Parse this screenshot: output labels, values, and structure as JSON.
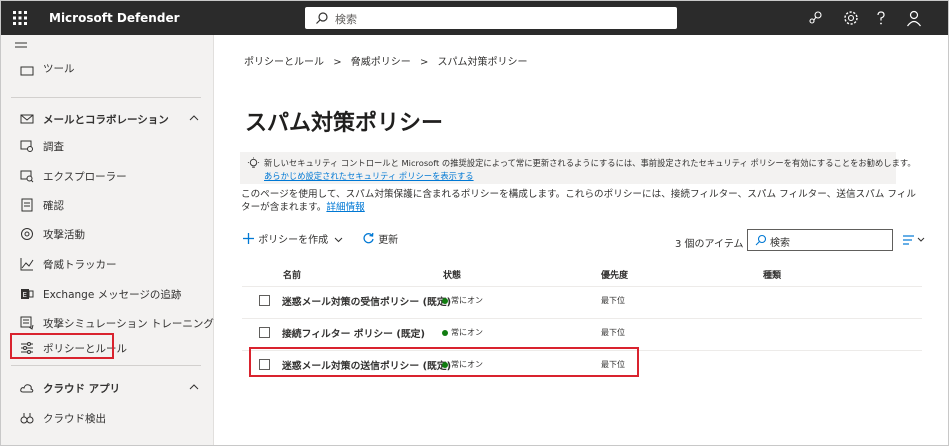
{
  "topbar": {
    "app_title": "Microsoft Defender",
    "search_placeholder": "検索",
    "icons": [
      "app-launcher-icon",
      "search-icon",
      "connection-icon",
      "settings-icon",
      "help-icon",
      "account-icon"
    ]
  },
  "sidebar": {
    "partial_item": "ツール",
    "items": [
      {
        "label": "メールとコラボレーション",
        "icon": "mail-icon"
      },
      {
        "label": "調査",
        "icon": "investigation-icon"
      },
      {
        "label": "エクスプローラー",
        "icon": "explorer-icon"
      },
      {
        "label": "確認",
        "icon": "review-icon"
      },
      {
        "label": "攻撃活動",
        "icon": "campaign-icon"
      },
      {
        "label": "脅威トラッカー",
        "icon": "trend-icon"
      },
      {
        "label": "Exchange メッセージの追跡",
        "icon": "exchange-icon"
      },
      {
        "label": "攻撃シミュレーション トレーニング",
        "icon": "simulation-icon"
      },
      {
        "label": "ポリシーとルール",
        "icon": "policy-icon"
      },
      {
        "label": "クラウド アプリ",
        "icon": "cloud-icon"
      },
      {
        "label": "クラウド検出",
        "icon": "binoculars-icon"
      }
    ]
  },
  "breadcrumb": [
    "ポリシーとルール",
    "脅威ポリシー",
    "スパム対策ポリシー"
  ],
  "breadcrumb_separator": ">",
  "page_title": "スパム対策ポリシー",
  "info": {
    "text": "新しいセキュリティ コントロールと Microsoft の推奨設定によって常に更新されるようにするには、事前設定されたセキュリティ ポリシーを有効にすることをお勧めします。",
    "link": "あらかじめ設定されたセキュリティ ポリシーを表示する"
  },
  "description": {
    "text": "このページを使用して、スパム対策保護に含まれるポリシーを構成します。これらのポリシーには、接続フィルター、スパム フィルター、送信スパム フィルターが含まれます。",
    "link": "詳細情報"
  },
  "toolbar": {
    "create_label": "ポリシーを作成",
    "refresh_label": "更新",
    "item_count": "3 個のアイテム",
    "search_placeholder": "検索"
  },
  "table": {
    "columns": [
      "名前",
      "状態",
      "優先度",
      "種類"
    ],
    "rows": [
      {
        "name": "迷惑メール対策の受信ポリシー (既定)",
        "status": "常にオン",
        "priority": "最下位"
      },
      {
        "name": "接続フィルター ポリシー (既定)",
        "status": "常にオン",
        "priority": "最下位"
      },
      {
        "name": "迷惑メール対策の送信ポリシー (既定)",
        "status": "常にオン",
        "priority": "最下位"
      }
    ]
  },
  "colors": {
    "topbar": "#2b2b2b",
    "accent": "#0078d4",
    "highlight": "#d9232e",
    "status_on": "#107c10"
  }
}
